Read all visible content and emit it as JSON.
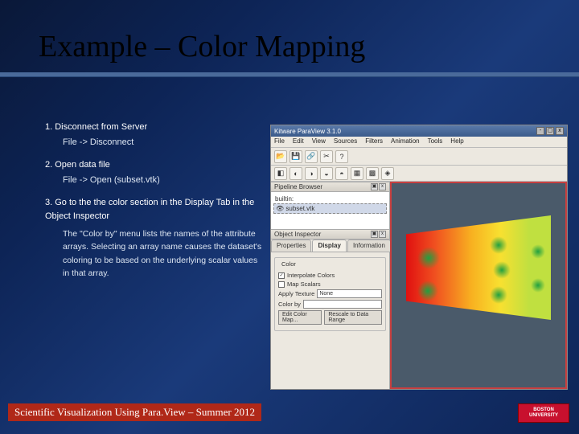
{
  "title": "Example – Color Mapping",
  "steps": [
    {
      "title": "1. Disconnect from Server",
      "cmd": "File -> Disconnect"
    },
    {
      "title": "2. Open data file",
      "cmd": "File -> Open (subset.vtk)"
    },
    {
      "title": "3. Go to the the color section in the Display Tab in the Object Inspector",
      "body": "The \"Color by\" menu lists the names of the attribute arrays. Selecting an array name causes the dataset's coloring to be based on the underlying scalar values in that array."
    }
  ],
  "paraview": {
    "window_title": "Kitware ParaView 3.1.0",
    "menus": [
      "File",
      "Edit",
      "View",
      "Sources",
      "Filters",
      "Animation",
      "Tools",
      "Help"
    ],
    "pipeline_header": "Pipeline Browser",
    "pipeline": {
      "root": "builtin:",
      "item": "subset.vtk"
    },
    "inspector_header": "Object Inspector",
    "tabs": [
      "Properties",
      "Display",
      "Information"
    ],
    "display": {
      "group_color": "Color",
      "interp": "Interpolate Colors",
      "map_scalars": "Map Scalars",
      "apply_texture_label": "Apply Texture",
      "apply_texture_value": "None",
      "color_by_label": "Color by",
      "edit_color_map": "Edit Color Map...",
      "rescale": "Rescale to Data Range"
    }
  },
  "footer": "Scientific Visualization Using Para.View – Summer 2012",
  "logo": {
    "line1": "BOSTON",
    "line2": "UNIVERSITY"
  }
}
